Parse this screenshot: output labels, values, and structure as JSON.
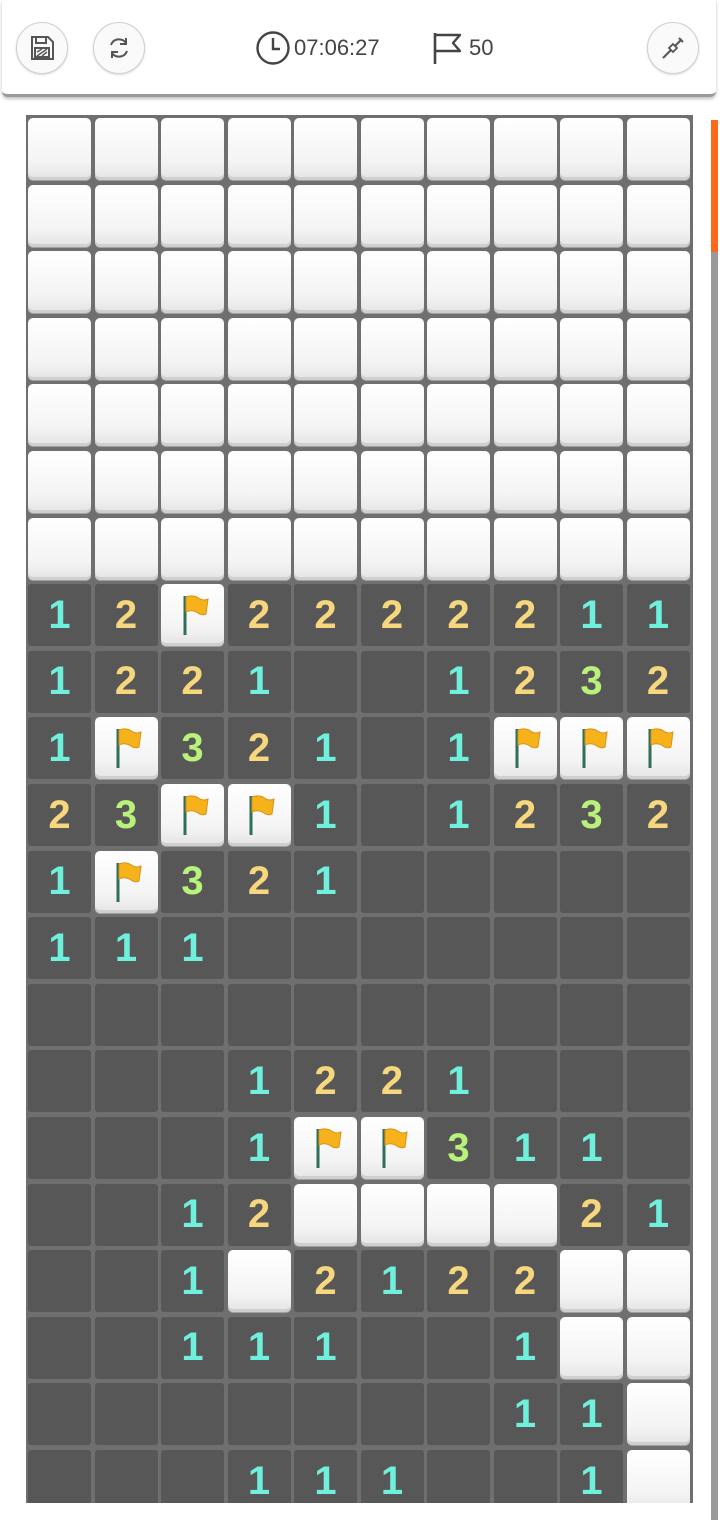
{
  "toolbar": {
    "timer": "07:06:27",
    "flags_remaining": "50",
    "icons": {
      "save": "floppy-disk-icon",
      "restart": "refresh-icon",
      "timer": "clock-icon",
      "flags": "flag-outline-icon",
      "mode": "shovel-icon"
    }
  },
  "colors": {
    "one": "#6ff0dc",
    "two": "#f7d77e",
    "three": "#b8f27a",
    "flag": "#f5b21a",
    "accent": "#ff6a1a"
  },
  "board": {
    "cols": 10,
    "legend": "H = covered tile, F = flagged tile, 0 = empty revealed, digits = adjacent mine count",
    "rows": [
      "HHHHHHHHHH",
      "HHHHHHHHHH",
      "HHHHHHHHHH",
      "HHHHHHHHHH",
      "HHHHHHHHHH",
      "HHHHHHHHHH",
      "HHHHHHHHHH",
      "12F2222211",
      "1221001232",
      "1F32101FFF",
      "23FF101232",
      "1F32100000",
      "1110000000",
      "0000000000",
      "0001221000",
      "0001FF3110",
      "0012HHHH21",
      "001H2122HH",
      "00111001HH",
      "00000001 1H",
      "0001110010H"
    ]
  }
}
